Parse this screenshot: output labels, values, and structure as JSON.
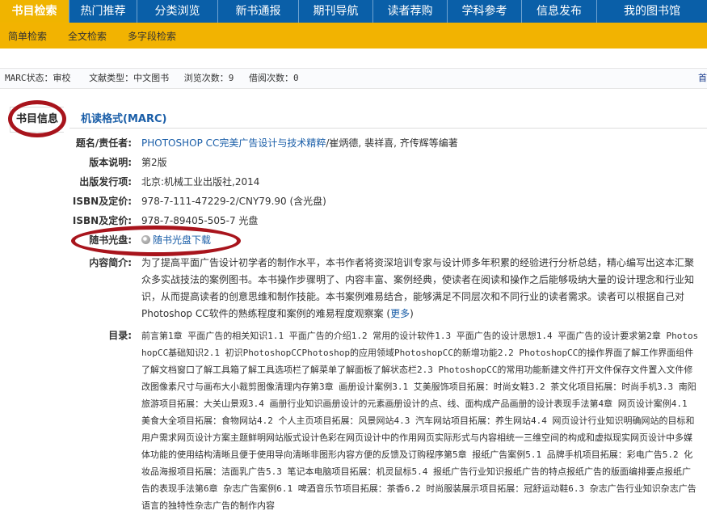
{
  "topnav": {
    "items": [
      "书目检索",
      "热门推荐",
      "分类浏览",
      "新书通报",
      "期刊导航",
      "读者荐购",
      "学科参考",
      "信息发布",
      "我的图书馆"
    ]
  },
  "subnav": {
    "items": [
      "简单检索",
      "全文检索",
      "多字段检索"
    ]
  },
  "status": {
    "marc_state": "MARC状态：审校",
    "doc_type": "文献类型：中文图书",
    "views": "浏览次数：9",
    "borrows": "借阅次数：0",
    "more": "首"
  },
  "tabs": {
    "bib_info": "书目信息",
    "marc": "机读格式(MARC)"
  },
  "record": {
    "title_label": "题名/责任者:",
    "title_link": "PHOTOSHOP CC完美广告设计与技术精粹",
    "title_rest": "/崔炳德, 裴祥喜, 齐传辉等编著",
    "edition_label": "版本说明:",
    "edition": "第2版",
    "publish_label": "出版发行项:",
    "publish": "北京:机械工业出版社,2014",
    "isbn1_label": "ISBN及定价:",
    "isbn1": "978-7-111-47229-2/CNY79.90 (含光盘)",
    "isbn2_label": "ISBN及定价:",
    "isbn2": "978-7-89405-505-7 光盘",
    "cd_label": "随书光盘:",
    "cd_link": "随书光盘下载",
    "intro_label": "内容简介:",
    "intro": "为了提高平面广告设计初学者的制作水平，本书作者将资深培训专家与设计师多年积累的经验进行分析总结，精心编写出这本汇聚众多实战技法的案例图书。本书操作步骤明了、内容丰富、案例经典，使读者在阅读和操作之后能够吸纳大量的设计理念和行业知识，从而提高读者的创意思维和制作技能。本书案例难易结合，能够满足不同层次和不同行业的读者需求。读者可以根据自己对Photoshop CC软件的熟练程度和案例的难易程度观察案 (",
    "intro_more": "更多",
    "intro_end": ")",
    "toc_label": "目录:",
    "toc": "前言第1章  平面广告的相关知识1.1 平面广告的介绍1.2 常用的设计软件1.3 平面广告的设计思想1.4 平面广告的设计要求第2章  PhotoshopCC基础知识2.1 初识PhotoshopCCPhotoshop的应用领域PhotoshopCC的新增功能2.2 PhotoshopCC的操作界面了解工作界面组件了解文档窗口了解工具箱了解工具选项栏了解菜单了解面板了解状态栏2.3 PhotoshopCC的常用功能新建文件打开文件保存文件置入文件修改图像素尺寸与画布大小裁剪图像清理内存第3章  画册设计案例3.1 艾美服饰项目拓展：时尚女鞋3.2 茶文化项目拓展：时尚手机3.3 南阳旅游项目拓展：大关山景观3.4 画册行业知识画册设计的元素画册设计的点、线、面构成产品画册的设计表现手法第4章  网页设计案例4.1 美食大全项目拓展：食物网站4.2 个人主页项目拓展：风景网站4.3 汽车网站项目拓展：养生网站4.4 网页设计行业知识明确网站的目标和用户需求网页设计方案主题鲜明网站版式设计色彩在网页设计中的作用网页实际形式与内容相统一三维空间的构成和虚拟现实网页设计中多媒体功能的使用结构清晰且便于使用导向清晰非图形内容方便的反馈及订购程序第5章  报纸广告案例5.1 品牌手机项目拓展：彩电广告5.2 化妆品海报项目拓展：洁面乳广告5.3 笔记本电脑项目拓展：机灵鼠标5.4 报纸广告行业知识报纸广告的特点报纸广告的版面编排要点报纸广告的表现手法第6章  杂志广告案例6.1 啤酒音乐节项目拓展：茶香6.2 时尚服装展示项目拓展：冠舒运动鞋6.3 杂志广告行业知识杂志广告语言的独特性杂志广告的制作内容"
  }
}
